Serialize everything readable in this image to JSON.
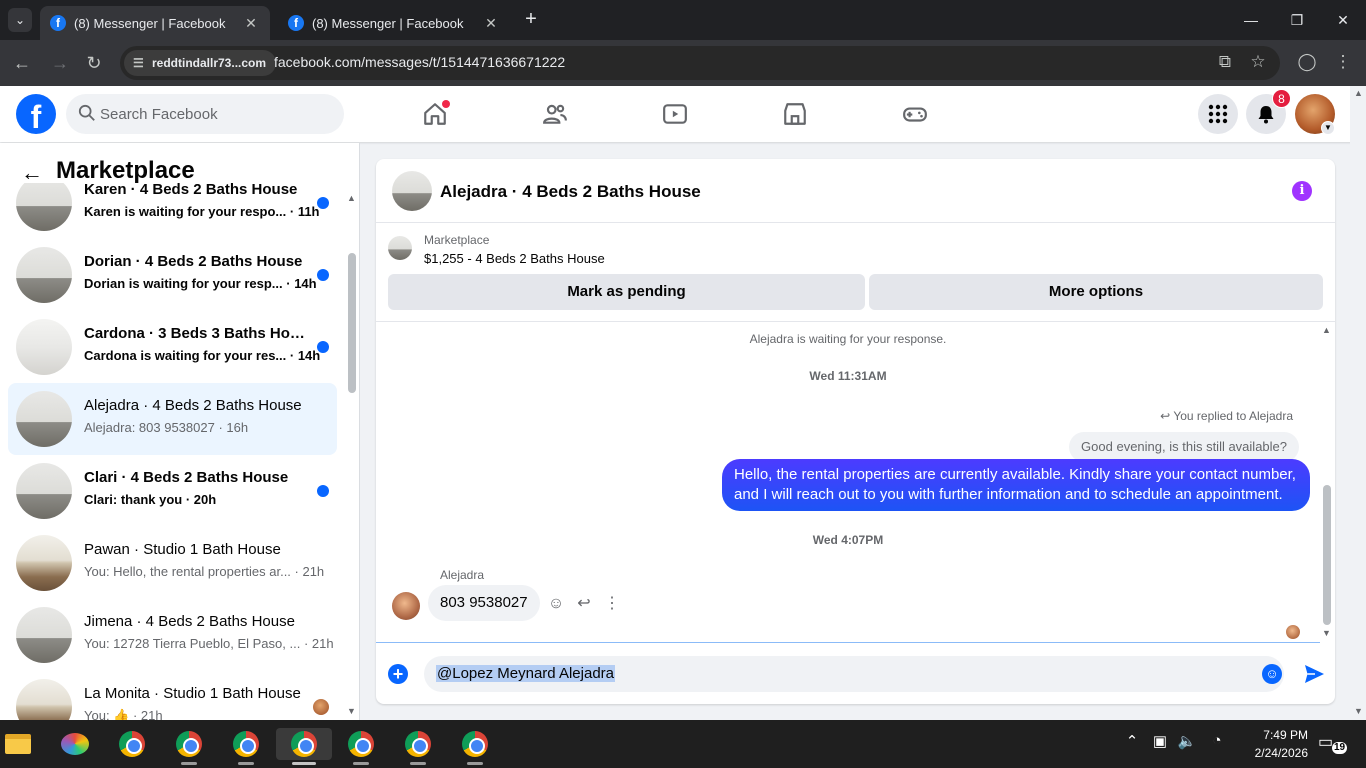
{
  "browser": {
    "tabs": [
      {
        "title": "(8) Messenger | Facebook",
        "active": true
      },
      {
        "title": "(8) Messenger | Facebook",
        "active": false
      }
    ],
    "site_chip": "reddtindallr73...com",
    "url": "facebook.com/messages/t/1514471636671222"
  },
  "facebook": {
    "search_placeholder": "Search Facebook",
    "notifications_count": "8",
    "brand_color": "#0866ff"
  },
  "sidebar": {
    "title": "Marketplace",
    "conversations": [
      {
        "name": "Karen · 4 Beds 2 Baths House",
        "preview": "Karen is waiting for your respo... · 11h",
        "unread": true,
        "thumb": "room-empty"
      },
      {
        "name": "Dorian · 4 Beds 2 Baths House",
        "preview": "Dorian is waiting for your resp... · 14h",
        "unread": true,
        "thumb": "room-empty"
      },
      {
        "name": "Cardona · 3 Beds 3 Baths House",
        "preview": "Cardona is waiting for your res... · 14h",
        "unread": true,
        "thumb": "room-white"
      },
      {
        "name": "Alejadra · 4 Beds 2 Baths House",
        "preview": "Alejadra: 803 9538027 · 16h",
        "unread": false,
        "selected": true,
        "thumb": "room-empty"
      },
      {
        "name": "Clari · 4 Beds 2 Baths House",
        "preview": "Clari: thank you · 20h",
        "unread": true,
        "thumb": "room-empty"
      },
      {
        "name": "Pawan · Studio 1 Bath House",
        "preview": "You: Hello, the rental properties ar... · 21h",
        "unread": false,
        "thumb": "room-furn"
      },
      {
        "name": "Jimena · 4 Beds 2 Baths House",
        "preview": "You: 12728 Tierra Pueblo, El Paso, ... · 21h",
        "unread": false,
        "thumb": "room-empty"
      },
      {
        "name": "La Monita · Studio 1 Bath House",
        "preview": "You: 👍 · 21h",
        "unread": false,
        "seen_avatar": true,
        "thumb": "room-furn"
      }
    ]
  },
  "chat": {
    "title": "Alejadra · 4 Beds 2 Baths House",
    "listing": {
      "source": "Marketplace",
      "title": "$1,255 - 4 Beds 2 Baths House",
      "mark_pending_label": "Mark as pending",
      "more_options_label": "More options"
    },
    "system_notice": "Alejadra is waiting for your response.",
    "timestamp_1": "Wed 11:31AM",
    "replied_label": "You replied to Alejadra",
    "quoted_message": "Good evening, is this still available?",
    "outgoing_message": "Hello, the rental properties are currently available. Kindly share your contact number, and I will reach out to you with further information and to schedule an appointment.",
    "timestamp_2": "Wed 4:07PM",
    "incoming_sender": "Alejadra",
    "incoming_message": "803 9538027",
    "composer_text": "@Lopez Meynard Alejadra"
  },
  "taskbar": {
    "time": "7:49 PM",
    "date": "2/24/2026",
    "notification_count": "19"
  }
}
